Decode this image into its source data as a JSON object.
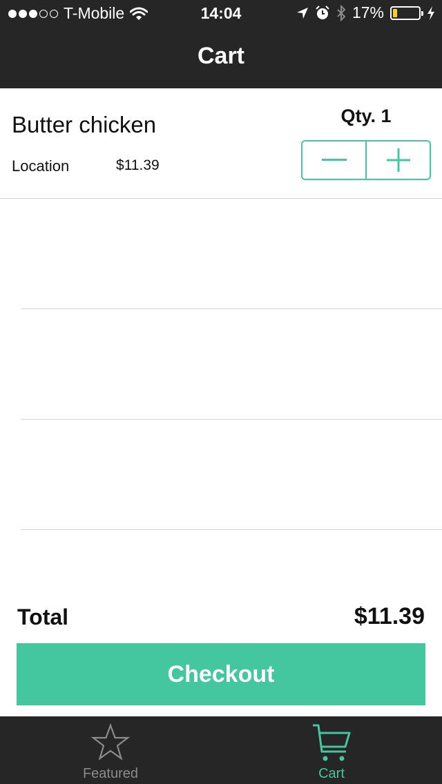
{
  "status_bar": {
    "carrier": "T-Mobile",
    "time": "14:04",
    "battery": "17%",
    "battery_level": 0.17
  },
  "nav": {
    "title": "Cart"
  },
  "cart_item": {
    "name": "Butter chicken",
    "location": "Location",
    "price": "$11.39",
    "qty_label": "Qty. 1"
  },
  "summary": {
    "total_label": "Total",
    "total_value": "$11.39",
    "checkout_label": "Checkout"
  },
  "tabs": [
    {
      "label": "Featured",
      "icon": "star-icon",
      "selected": false
    },
    {
      "label": "Cart",
      "icon": "cart-icon",
      "selected": true
    }
  ],
  "colors": {
    "accent": "#44c79f",
    "bar_background": "#262626",
    "inactive_tab": "#8b8b8b",
    "battery_fill": "#f7d21c"
  }
}
